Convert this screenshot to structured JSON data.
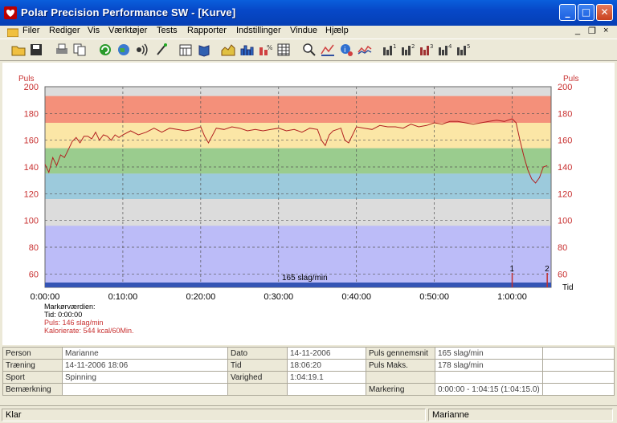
{
  "window": {
    "title": "Polar Precision Performance SW - [Kurve]",
    "minimize": "_",
    "maximize": "□",
    "close": "✕"
  },
  "menu": {
    "items": [
      "Filer",
      "Rediger",
      "Vis",
      "Værktøjer",
      "Tests",
      "Rapporter",
      "Indstillinger",
      "Vindue",
      "Hjælp"
    ],
    "mdi_min": "_",
    "mdi_restore": "❐",
    "mdi_close": "×"
  },
  "toolbar": {
    "icons": [
      "open-folder-icon",
      "save-icon",
      "print-icon",
      "copy-icon",
      "refresh-icon",
      "globe-icon",
      "sound-icon",
      "wand-icon",
      "calendar-icon",
      "book-icon",
      "area-chart-icon",
      "histogram-icon",
      "percent-chart-icon",
      "table-grid-icon",
      "zoom-icon",
      "curve-analysis-icon",
      "info-icon",
      "compare-curves-icon",
      "bar-chart-1-icon",
      "bar-chart-2-icon",
      "bar-chart-3-icon",
      "bar-chart-4-icon",
      "bar-chart-5-icon"
    ]
  },
  "chart": {
    "ylabel_left": "Puls",
    "ylabel_right": "Puls",
    "xlabel": "Tid",
    "avg_label": "165 slag/min",
    "marker_labels": [
      "1",
      "2"
    ],
    "readout_title": "Markørværdien:",
    "readout_time": "Tid: 0:00:00",
    "readout_pulse": "Puls: 146 slag/min",
    "readout_calories": "Kalorierate: 544 kcal/60Min.",
    "colors": {
      "zone_red": "#f4907a",
      "zone_yellow": "#fbe6a6",
      "zone_green": "#9acc8e",
      "zone_blue": "#9ccadc",
      "zone_gray": "#dcdcdc",
      "zone_lavender": "#bcbcf8",
      "line": "#b22020",
      "axis_text": "#c83030",
      "bottom_bar": "#3454b4"
    }
  },
  "chart_data": {
    "type": "line",
    "ylabel": "Puls",
    "xlabel": "Tid",
    "ylim": [
      50,
      200
    ],
    "xlim_minutes": [
      0,
      65
    ],
    "yticks": [
      200,
      180,
      160,
      140,
      120,
      100,
      80,
      60
    ],
    "xticks": [
      "0:00:00",
      "0:10:00",
      "0:20:00",
      "0:30:00",
      "0:40:00",
      "0:50:00",
      "1:00:00"
    ],
    "zones": [
      {
        "from": 173,
        "to": 193,
        "color": "#f4907a"
      },
      {
        "from": 154,
        "to": 173,
        "color": "#fbe6a6"
      },
      {
        "from": 135,
        "to": 154,
        "color": "#9acc8e"
      },
      {
        "from": 116,
        "to": 135,
        "color": "#9ccadc"
      },
      {
        "from": 96,
        "to": 116,
        "color": "#dcdcdc"
      },
      {
        "from": 50,
        "to": 96,
        "color": "#bcbcf8"
      }
    ],
    "series": [
      {
        "x": [
          0,
          0.5,
          1,
          1.5,
          2,
          2.5,
          3,
          3.5,
          4,
          4.5,
          5,
          5.5,
          6,
          6.5,
          7,
          7.5,
          8,
          8.5,
          9,
          9.5,
          10,
          11,
          12,
          13,
          14,
          15,
          16,
          17,
          18,
          19,
          20,
          20.5,
          21,
          22,
          23,
          24,
          25,
          26,
          27,
          28,
          29,
          30,
          31,
          32,
          33,
          34,
          35,
          35.5,
          36,
          36.5,
          37,
          38,
          38.5,
          39,
          40,
          41,
          42,
          43,
          44,
          45,
          46,
          47,
          48,
          49,
          50,
          51,
          52,
          53,
          54,
          55,
          56,
          57,
          58,
          59,
          60,
          60.5,
          61,
          61.5,
          62,
          62.5,
          63,
          63.5,
          64,
          64.5
        ],
        "y": [
          142,
          136,
          147,
          141,
          149,
          147,
          153,
          159,
          162,
          158,
          163,
          163,
          161,
          166,
          160,
          164,
          163,
          160,
          164,
          162,
          164,
          167,
          164,
          166,
          169,
          166,
          169,
          168,
          167,
          168,
          170,
          163,
          158,
          169,
          168,
          170,
          169,
          167,
          168,
          167,
          168,
          169,
          167,
          168,
          166,
          169,
          168,
          160,
          156,
          164,
          167,
          169,
          160,
          158,
          170,
          169,
          168,
          171,
          170,
          170,
          169,
          172,
          170,
          171,
          173,
          172,
          174,
          174,
          173,
          172,
          173,
          174,
          175,
          174,
          176,
          173,
          160,
          148,
          138,
          131,
          128,
          132,
          140,
          141
        ]
      }
    ],
    "markers": [
      {
        "label": "1",
        "x_minutes": 60
      },
      {
        "label": "2",
        "x_minutes": 64.5
      }
    ],
    "avg_line": {
      "value": 54,
      "label": "165 slag/min"
    }
  },
  "info": {
    "rows": [
      [
        "Person",
        "Marianne",
        "Dato",
        "14-11-2006",
        "Puls gennemsnit",
        "165 slag/min",
        ""
      ],
      [
        "Træning",
        "14-11-2006 18:06",
        "Tid",
        "18:06:20",
        "Puls Maks.",
        "178 slag/min",
        ""
      ],
      [
        "Sport",
        "Spinning",
        "Varighed",
        "1:04:19.1",
        "",
        "",
        ""
      ],
      [
        "Bemærkning",
        "",
        "",
        "",
        "Markering",
        "0:00:00 - 1:04:15 (1:04:15.0)",
        ""
      ]
    ]
  },
  "status": {
    "left": "Klar",
    "user": "Marianne"
  }
}
